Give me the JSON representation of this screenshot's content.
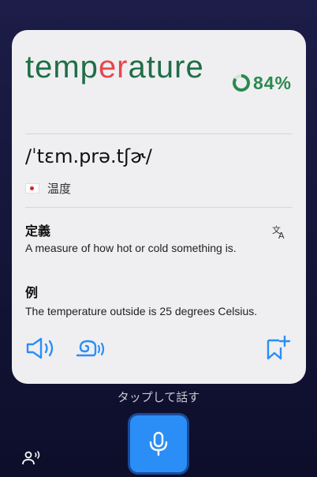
{
  "word": {
    "before": "temp",
    "highlight": "er",
    "after": "ature"
  },
  "score": {
    "value": 0.84,
    "text": "84%"
  },
  "pronunciation": "/ˈtɛm.prə.tʃɚ/",
  "translation": {
    "flag_icon": "japan-flag-icon",
    "text": "温度"
  },
  "definition": {
    "label": "定義",
    "text": "A measure of how hot or cold something is."
  },
  "example": {
    "label": "例",
    "text": "The temperature outside is 25 degrees Celsius."
  },
  "actions": {
    "icons": [
      "speaker-icon",
      "slow-speaker-icon",
      "bookmark-add-icon",
      "translate-icon",
      "mic-icon",
      "person-voice-icon"
    ]
  },
  "bottom": {
    "tap_label": "タップして話す"
  },
  "colors": {
    "word": "#1f6e47",
    "highlight": "#e5484d",
    "accent": "#2b8ef6",
    "score": "#2b8a4e"
  }
}
